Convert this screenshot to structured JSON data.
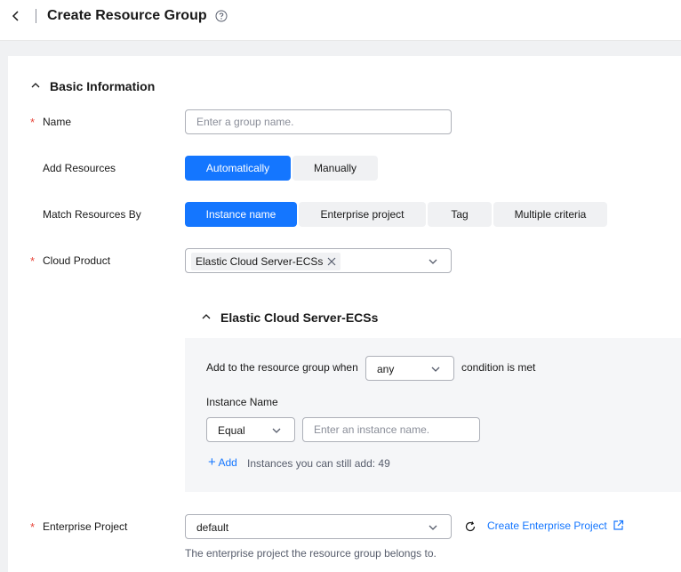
{
  "header": {
    "title": "Create Resource Group"
  },
  "basic": {
    "section_title": "Basic Information",
    "required_mark": "*",
    "name_label": "Name",
    "name_placeholder": "Enter a group name.",
    "add_resources_label": "Add Resources",
    "add_options": [
      "Automatically",
      "Manually"
    ],
    "add_selected": "Automatically",
    "match_label": "Match Resources By",
    "match_options": [
      "Instance name",
      "Enterprise project",
      "Tag",
      "Multiple criteria"
    ],
    "match_selected": "Instance name",
    "cloud_product_label": "Cloud Product",
    "cloud_product_tag": "Elastic Cloud Server-ECSs"
  },
  "ecs": {
    "section_title": "Elastic Cloud Server-ECSs",
    "condition_prefix": "Add to the resource group when",
    "condition_value": "any",
    "condition_suffix": "condition is met",
    "instance_name_label": "Instance Name",
    "operator_value": "Equal",
    "instance_placeholder": "Enter an instance name.",
    "add_label": "Add",
    "remaining_text": "Instances you can still add: 49"
  },
  "enterprise": {
    "label": "Enterprise Project",
    "value": "default",
    "create_link": "Create Enterprise Project",
    "hint": "The enterprise project the resource group belongs to."
  },
  "colors": {
    "primary": "#1476ff",
    "required": "#e7463b",
    "segment_bg": "#f0f1f3"
  }
}
